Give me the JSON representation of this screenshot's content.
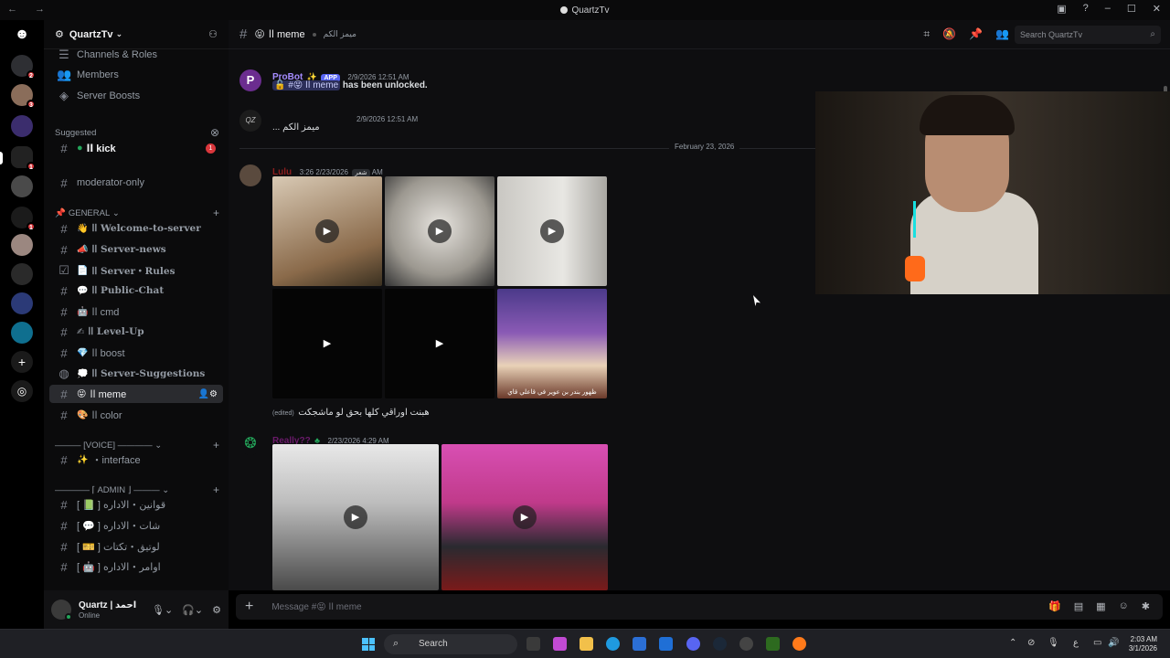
{
  "window": {
    "title": "QuartzTv",
    "controls": [
      "–",
      "☐",
      "✕"
    ]
  },
  "guilds": [
    {
      "name": "discord-home-icon",
      "badge": ""
    },
    {
      "name": "server-1",
      "badge": "2"
    },
    {
      "name": "server-2",
      "badge": "3"
    },
    {
      "name": "server-3",
      "badge": ""
    },
    {
      "name": "server-quartz",
      "badge": "1"
    },
    {
      "name": "server-4",
      "badge": ""
    },
    {
      "name": "server-5",
      "badge": "1"
    },
    {
      "name": "server-6",
      "badge": ""
    },
    {
      "name": "server-7",
      "badge": ""
    },
    {
      "name": "server-8",
      "badge": ""
    },
    {
      "name": "server-9",
      "badge": ""
    }
  ],
  "server": {
    "name": "QuartzTv"
  },
  "sidebar": {
    "top_items": [
      {
        "label": "Channels & Roles",
        "icon": "☰"
      },
      {
        "label": "Members",
        "icon": "👥"
      },
      {
        "label": "Server Boosts",
        "icon": "◈"
      }
    ],
    "suggested_label": "Suggested",
    "suggested": {
      "label": "اا kick",
      "badge": "1"
    },
    "moderator": "moderator-only",
    "general_category": "GENERAL",
    "general": [
      {
        "emoji": "👋",
        "label": "اا Welcome-to-server",
        "icon": "#"
      },
      {
        "emoji": "📣",
        "label": "اا Server-news",
        "icon": "#"
      },
      {
        "emoji": "📄",
        "label": "اا Server・Rules",
        "icon": "☑"
      },
      {
        "emoji": "💬",
        "label": "اا Public-Chat",
        "icon": "#"
      },
      {
        "emoji": "🤖",
        "label": "اا cmd",
        "icon": "#"
      },
      {
        "emoji": "✍",
        "label": "اا Level-Up",
        "icon": "#"
      },
      {
        "emoji": "💎",
        "label": "اا boost",
        "icon": "#"
      },
      {
        "emoji": "💭",
        "label": "اا Server-Suggestions",
        "icon": "◍"
      },
      {
        "emoji": "😝",
        "label": "اا meme",
        "icon": "#"
      },
      {
        "emoji": "🎨",
        "label": "اا color",
        "icon": "#"
      }
    ],
    "voice_category": "[VOICE]",
    "voice": [
      {
        "emoji": "✨",
        "label": "・interface"
      }
    ],
    "admin_category": "⌈ ADMIN ⌋",
    "admin": [
      {
        "label": "[ 📗 ] قوانين・الاداره"
      },
      {
        "label": "[ 💬 ] شات・الاداره"
      },
      {
        "label": "[ 🎫 ] لوتيق・تكتات"
      },
      {
        "label": "[ 🤖 ] اوامر・الاداره"
      }
    ]
  },
  "user": {
    "name": "Quartz | احمد",
    "status": "Online"
  },
  "channel": {
    "name": "اا meme",
    "emoji": "😝",
    "topic": "ميمز الكم"
  },
  "search": {
    "placeholder": "Search QuartzTv"
  },
  "messages": {
    "probot": {
      "author": "ProBot",
      "tag": "APP",
      "time": "2/9/2026 12:51 AM",
      "text_prefix": "🔓 #😝 اا meme",
      "text_bold": "has been unlocked."
    },
    "quartz1": {
      "time": "2/9/2026 12:51 AM",
      "text": "... ميمز الكم"
    },
    "date_divider": "February 23, 2026",
    "lulu": {
      "author": "Lulu",
      "tag": "شعر",
      "time": "2/23/2026 3:26 AM",
      "caption_edited": "(edited)",
      "caption": "هبنت اوراقي كلها بحق لو ماشجكت",
      "tile_caption": "ظهور بندر بن عوير في قاعلي قاي"
    },
    "reality": {
      "author": "Really??",
      "time": "2/23/2026 4:29 AM"
    }
  },
  "composer": {
    "placeholder": "Message #😝 اا meme"
  },
  "taskbar": {
    "search": "Search",
    "time": "2:03 AM",
    "date": "3/1/2026",
    "lang": "ع"
  }
}
